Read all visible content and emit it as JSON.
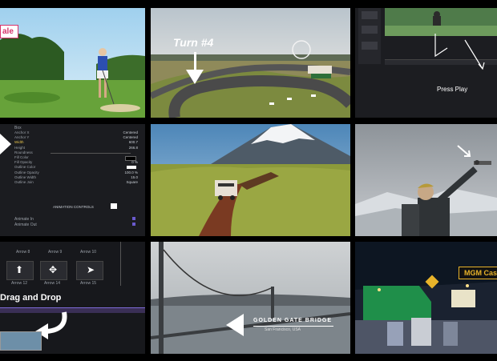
{
  "golf": {
    "badge": "ale"
  },
  "race": {
    "caption": "Turn #4"
  },
  "editor": {
    "play_label": "Press Play"
  },
  "properties": {
    "header": "Box",
    "rows": [
      {
        "label": "Anchor X",
        "value": "Centered"
      },
      {
        "label": "Anchor Y",
        "value": "Centered"
      },
      {
        "label": "Width",
        "value": "600.7"
      },
      {
        "label": "Height",
        "value": "266.8"
      },
      {
        "label": "Roundness",
        "value": ""
      },
      {
        "label": "Fill Color",
        "value": ""
      },
      {
        "label": "Fill Opacity",
        "value": "0 %"
      },
      {
        "label": "Outline Color",
        "value": ""
      },
      {
        "label": "Outline Opacity",
        "value": "100.0 %"
      },
      {
        "label": "Outline Width",
        "value": "15.0"
      },
      {
        "label": "Outline Join",
        "value": "Square"
      }
    ],
    "animation_label": "ANIMATION CONTROLS",
    "footer": [
      "Animate In",
      "Animate Out"
    ]
  },
  "arrows": {
    "labels": [
      "Arrow 8",
      "Arrow 9",
      "Arrow 10",
      "Arrow 12",
      "Arrow 14",
      "Arrow 15"
    ],
    "drag_label": "Drag and Drop"
  },
  "bridge": {
    "title": "GOLDEN GATE BRIDGE",
    "subtitle": "San Francisco, USA"
  },
  "vegas": {
    "label": "MGM Casi"
  },
  "colors": {
    "accent_gold": "#e8b32a",
    "panel": "#1b1c20"
  }
}
